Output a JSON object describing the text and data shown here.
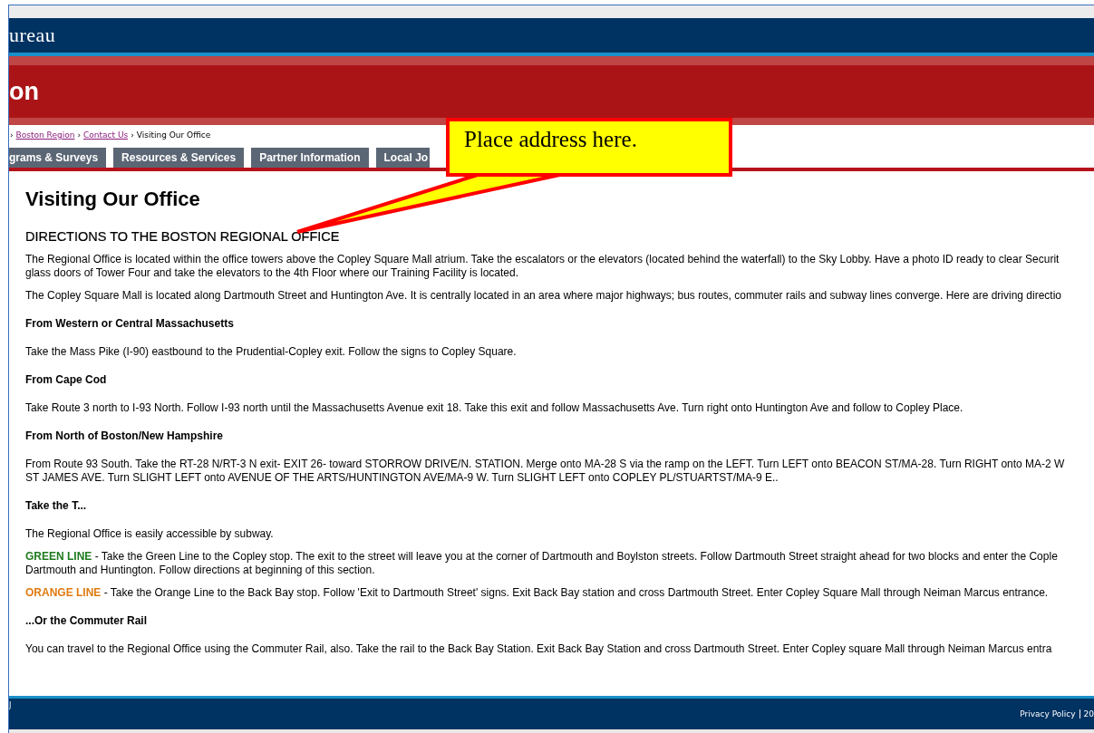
{
  "header": {
    "site_name": "ureau",
    "region_title": "on"
  },
  "breadcrumb": [
    {
      "kind": "separator",
      "text": "›"
    },
    {
      "kind": "link",
      "text": "Boston Region"
    },
    {
      "kind": "separator",
      "text": "›"
    },
    {
      "kind": "link",
      "text": "Contact Us"
    },
    {
      "kind": "separator",
      "text": "›"
    },
    {
      "kind": "current",
      "text": "Visiting Our Office"
    }
  ],
  "tabs": [
    {
      "label": "grams & Surveys",
      "selected": false
    },
    {
      "label": "Resources & Services",
      "selected": false
    },
    {
      "label": "Partner Information",
      "selected": false
    },
    {
      "label": "Local Jo",
      "selected": false
    }
  ],
  "callout": {
    "text": "Place address here."
  },
  "content": {
    "title": "Visiting Our Office",
    "subtitle": "DIRECTIONS TO THE BOSTON REGIONAL OFFICE",
    "blocks": [
      {
        "kind": "text",
        "lines": [
          "The Regional Office is located within the office towers above the Copley Square Mall atrium. Take the escalators or the elevators (located behind the waterfall) to the Sky Lobby. Have a photo ID ready to clear Securit",
          "glass doors of Tower Four and take the elevators to the 4th Floor where our Training Facility is located."
        ]
      },
      {
        "kind": "text",
        "lines": [
          "The Copley Square Mall is located along Dartmouth Street and Huntington Ave. It is centrally located in an area where major highways; bus routes, commuter rails and subway lines converge. Here are driving directio"
        ]
      },
      {
        "kind": "heading",
        "text": "From Western or Central Massachusetts"
      },
      {
        "kind": "text",
        "lines": [
          "Take the Mass Pike (I-90) eastbound to the Prudential-Copley exit. Follow the signs to Copley Square."
        ]
      },
      {
        "kind": "heading",
        "text": "From Cape Cod"
      },
      {
        "kind": "text",
        "lines": [
          "Take Route 3 north to I-93 North. Follow I-93 north until the Massachusetts Avenue exit 18. Take this exit and follow Massachusetts Ave. Turn right onto Huntington Ave and follow to Copley Place."
        ]
      },
      {
        "kind": "heading",
        "text": "From North of Boston/New Hampshire"
      },
      {
        "kind": "text",
        "lines": [
          "From Route 93 South. Take the RT-28 N/RT-3 N exit- EXIT 26- toward STORROW DRIVE/N. STATION. Merge onto MA-28 S via the ramp on the LEFT. Turn LEFT onto BEACON ST/MA-28. Turn RIGHT onto MA-2 W",
          "ST JAMES AVE. Turn SLIGHT LEFT onto AVENUE OF THE ARTS/HUNTINGTON AVE/MA-9 W. Turn SLIGHT LEFT onto COPLEY PL/STUARTST/MA-9 E.."
        ]
      },
      {
        "kind": "heading",
        "text": "Take the T..."
      },
      {
        "kind": "text",
        "lines": [
          "The Regional Office is easily accessible by subway."
        ]
      },
      {
        "kind": "line",
        "label": "GREEN LINE",
        "color": "#1e7a1e",
        "lines": [
          " - Take the Green Line to the Copley stop. The exit to the street will leave you at the corner of Dartmouth and Boylston streets. Follow Dartmouth Street straight ahead for two blocks and enter the Cople",
          "Dartmouth and Huntington. Follow directions at beginning of this section."
        ]
      },
      {
        "kind": "line",
        "label": "ORANGE LINE",
        "color": "#e07b10",
        "lines": [
          " - Take the Orange Line to the Back Bay stop. Follow 'Exit to Dartmouth Street' signs. Exit Back Bay station and cross Dartmouth Street. Enter Copley Square Mall through Neiman Marcus entrance."
        ]
      },
      {
        "kind": "heading",
        "text": "...Or the Commuter Rail"
      },
      {
        "kind": "text",
        "lines": [
          "You can travel to the Regional Office using the Commuter Rail, also. Take the rail to the Back Bay Station. Exit Back Bay Station and cross Dartmouth Street. Enter Copley square Mall through Neiman Marcus entra"
        ]
      }
    ]
  },
  "footer": {
    "left_fragment": "J",
    "links": [
      "Privacy Policy",
      "20"
    ]
  }
}
